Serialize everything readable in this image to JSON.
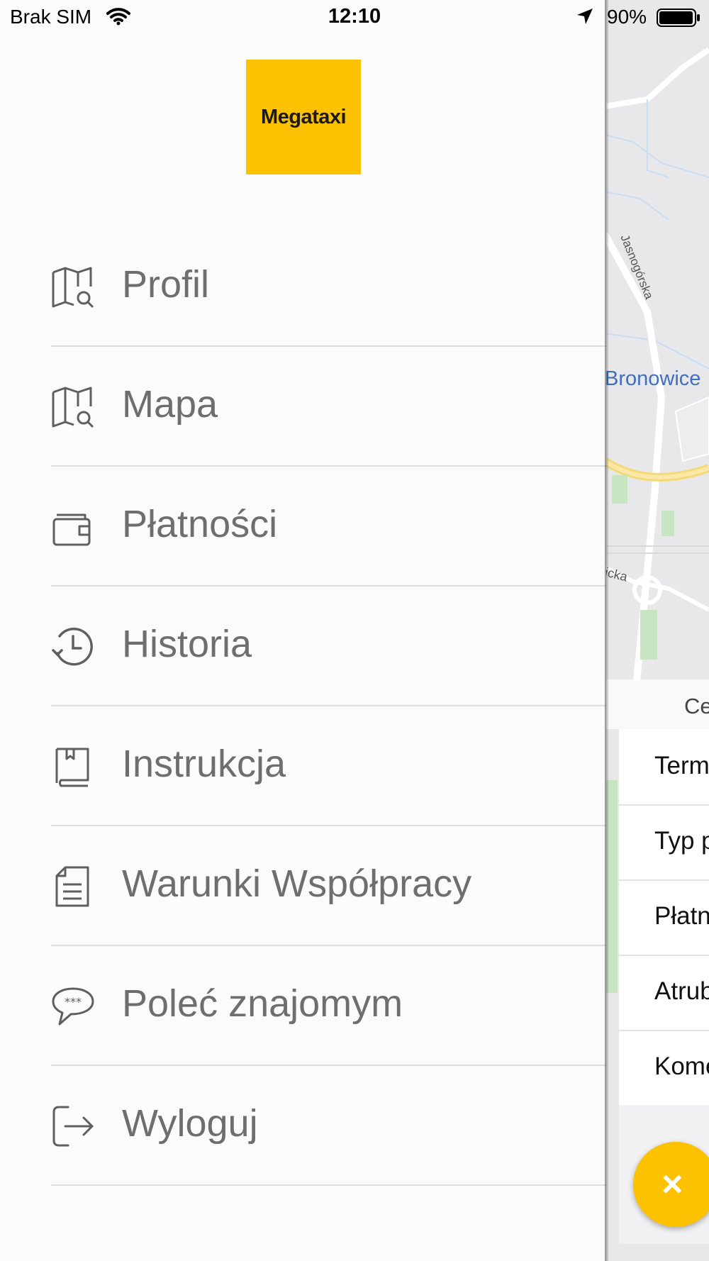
{
  "status_bar": {
    "carrier": "Brak SIM",
    "time": "12:10",
    "battery": "90%"
  },
  "logo": {
    "text": "Megataxi",
    "color": "#fcc100"
  },
  "menu": {
    "items": [
      {
        "label": "Profil",
        "icon": "map-search-icon"
      },
      {
        "label": "Mapa",
        "icon": "map-search-icon"
      },
      {
        "label": "Płatności",
        "icon": "wallet-icon"
      },
      {
        "label": "Historia",
        "icon": "history-clock-icon"
      },
      {
        "label": "Instrukcja",
        "icon": "book-icon"
      },
      {
        "label": "Warunki Współpracy",
        "icon": "document-icon"
      },
      {
        "label": "Poleć znajomym",
        "icon": "chat-bubble-icon"
      },
      {
        "label": "Wyloguj",
        "icon": "logout-icon"
      }
    ]
  },
  "map": {
    "place_label": "Bronowice",
    "street_label": "Jasnogórska",
    "street_label_2": "icka",
    "center_label": "Ce"
  },
  "order_sheet": {
    "rows": [
      "Term",
      "Typ p",
      "Płatn",
      "Atrub",
      "Kome"
    ]
  },
  "fab": {
    "symbol": "×",
    "color": "#fcc200"
  }
}
